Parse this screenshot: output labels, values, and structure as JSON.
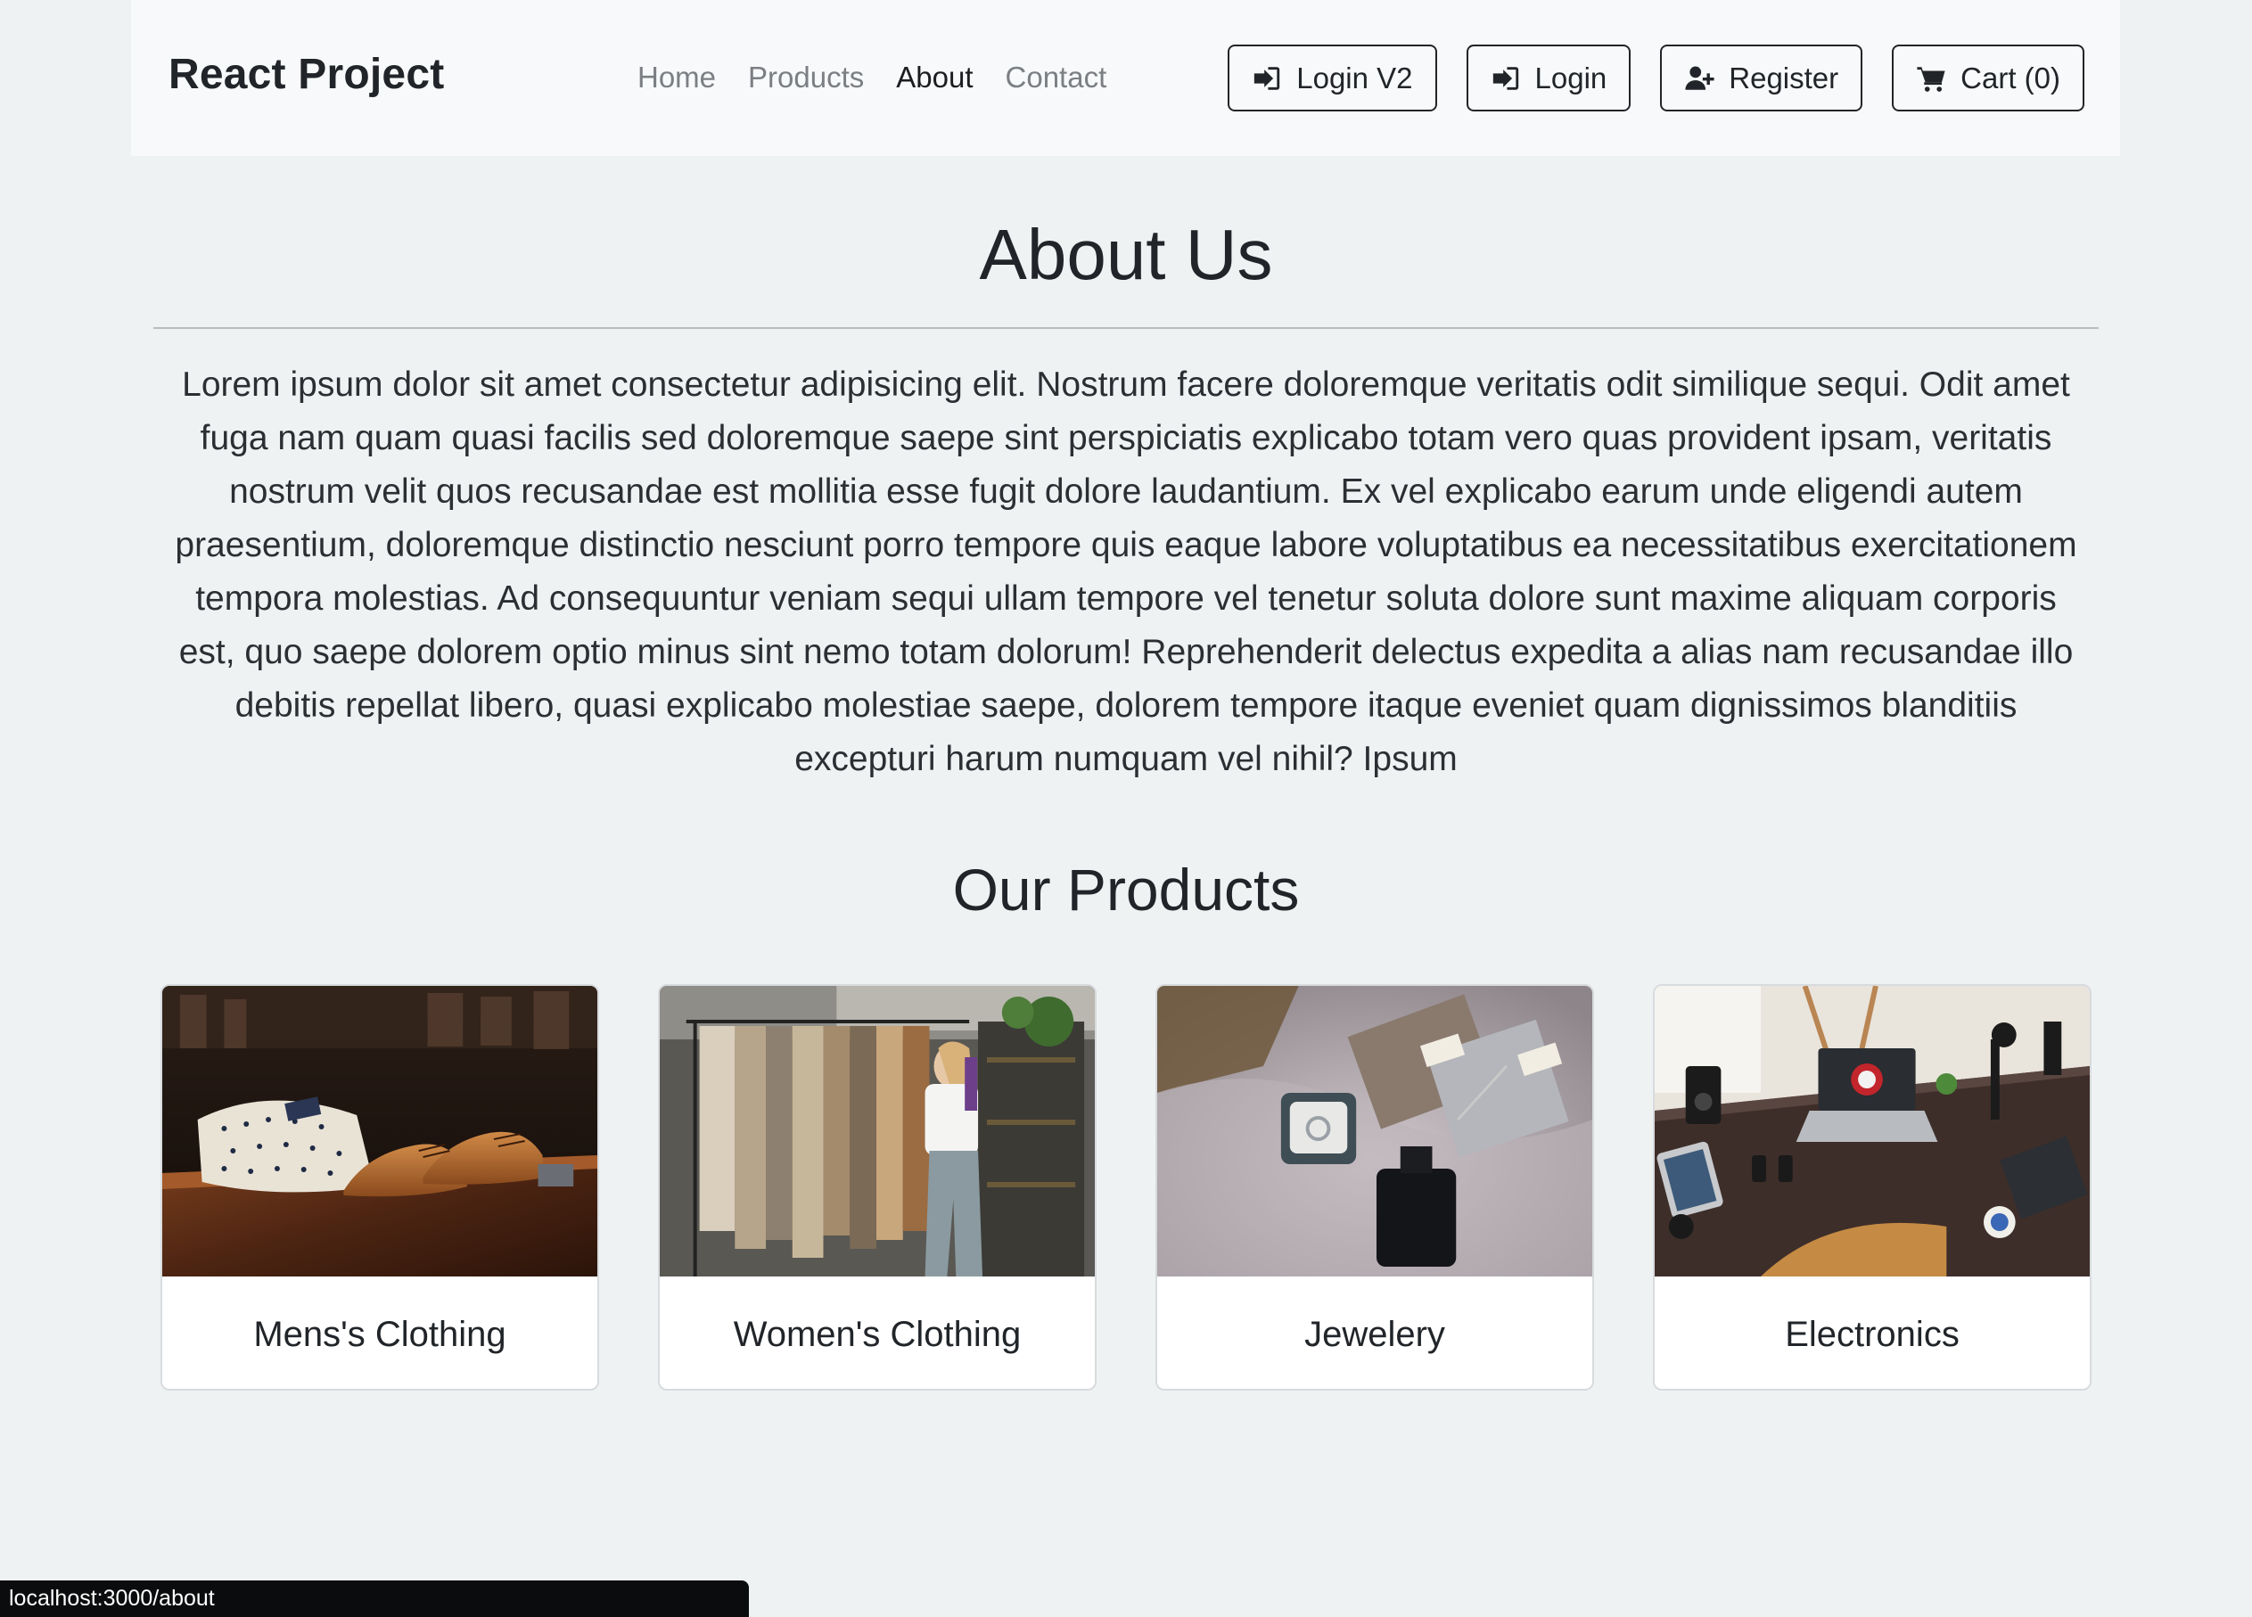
{
  "navbar": {
    "brand": "React Project",
    "links": [
      {
        "label": "Home",
        "active": false
      },
      {
        "label": "Products",
        "active": false
      },
      {
        "label": "About",
        "active": true
      },
      {
        "label": "Contact",
        "active": false
      }
    ],
    "actions": [
      {
        "label": "Login V2",
        "icon": "sign-in-icon"
      },
      {
        "label": "Login",
        "icon": "sign-in-icon"
      },
      {
        "label": "Register",
        "icon": "user-plus-icon"
      },
      {
        "label": "Cart (0)",
        "icon": "cart-icon"
      }
    ]
  },
  "about": {
    "title": "About Us",
    "body": "Lorem ipsum dolor sit amet consectetur adipisicing elit. Nostrum facere doloremque veritatis odit similique sequi. Odit amet fuga nam quam quasi facilis sed doloremque saepe sint perspiciatis explicabo totam vero quas provident ipsam, veritatis nostrum velit quos recusandae est mollitia esse fugit dolore laudantium. Ex vel explicabo earum unde eligendi autem praesentium, doloremque distinctio nesciunt porro tempore quis eaque labore voluptatibus ea necessitatibus exercitationem tempora molestias. Ad consequuntur veniam sequi ullam tempore vel tenetur soluta dolore sunt maxime aliquam corporis est, quo saepe dolorem optio minus sint nemo totam dolorum! Reprehenderit delectus expedita a alias nam recusandae illo debitis repellat libero, quasi explicabo molestiae saepe, dolorem tempore itaque eveniet quam dignissimos blanditiis excepturi harum numquam vel nihil? Ipsum"
  },
  "products": {
    "title": "Our Products",
    "cards": [
      {
        "label": "Mens's Clothing",
        "image": "mens-clothing-photo"
      },
      {
        "label": "Women's Clothing",
        "image": "womens-clothing-photo"
      },
      {
        "label": "Jewelery",
        "image": "jewelery-photo"
      },
      {
        "label": "Electronics",
        "image": "electronics-photo"
      }
    ]
  },
  "statusbar": {
    "url": "localhost:3000/about"
  },
  "colors": {
    "page_bg": "#eff2f3",
    "navbar_bg": "#f8f9fa",
    "text": "#212529",
    "muted_link": "#7b7f83"
  }
}
